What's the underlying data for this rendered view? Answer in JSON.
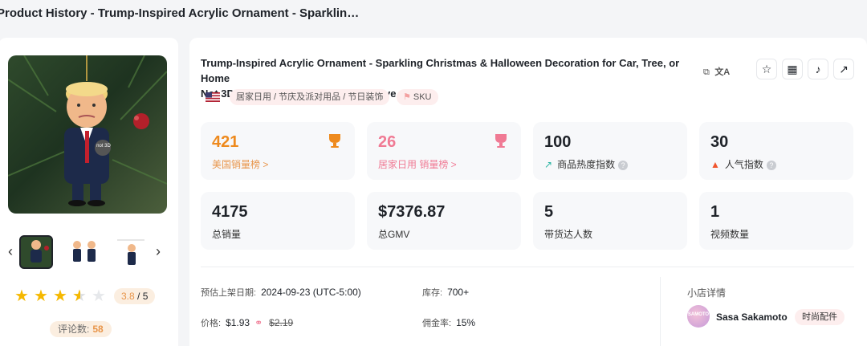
{
  "page": {
    "title": "Product History - Trump-Inspired Acrylic Ornament - Sparklin…"
  },
  "product": {
    "title_line1": "Trump-Inspired Acrylic Ornament - Sparkling Christmas & Halloween Decoration for Car, Tree, or Home",
    "title_line2": "Not 3D - Perfect Holiday Gift for Festive Cheer",
    "category_tag": "居家日用 / 节庆及派对用品 / 节日装饰",
    "sku_tag": "SKU",
    "image_badge": "not 3D"
  },
  "gallery": {
    "prev_arrow": "‹",
    "next_arrow": "›"
  },
  "rating": {
    "stars": 3.8,
    "score": "3.8",
    "max": "/ 5",
    "review_label": "评论数:",
    "review_count": "58"
  },
  "stats": {
    "us_rank": {
      "value": "421",
      "label": "美国销量榜 >"
    },
    "cat_rank": {
      "value": "26",
      "label": "居家日用 销量榜 >"
    },
    "heat": {
      "value": "100",
      "label": "商品热度指数"
    },
    "popularity": {
      "value": "30",
      "label": "人气指数"
    },
    "total_sales": {
      "value": "4175",
      "label": "总销量"
    },
    "gmv": {
      "value": "$7376.87",
      "label": "总GMV"
    },
    "creators": {
      "value": "5",
      "label": "带货达人数"
    },
    "videos": {
      "value": "1",
      "label": "视频数量"
    }
  },
  "details": {
    "listed_label": "预估上架日期:",
    "listed_value": "2024-09-23 (UTC-5:00)",
    "stock_label": "库存:",
    "stock_value": "700+",
    "price_label": "价格:",
    "price_value": "$1.93",
    "price_original": "$2.19",
    "commission_label": "佣金率:",
    "commission_value": "15%"
  },
  "shop": {
    "section_title": "小店详情",
    "name": "Sasa Sakamoto",
    "category": "时尚配件",
    "avatar_text": "SAMOTO"
  },
  "colors": {
    "accent_orange": "#ee8a1e",
    "accent_pink": "#f07a94",
    "star": "#f5b800"
  }
}
